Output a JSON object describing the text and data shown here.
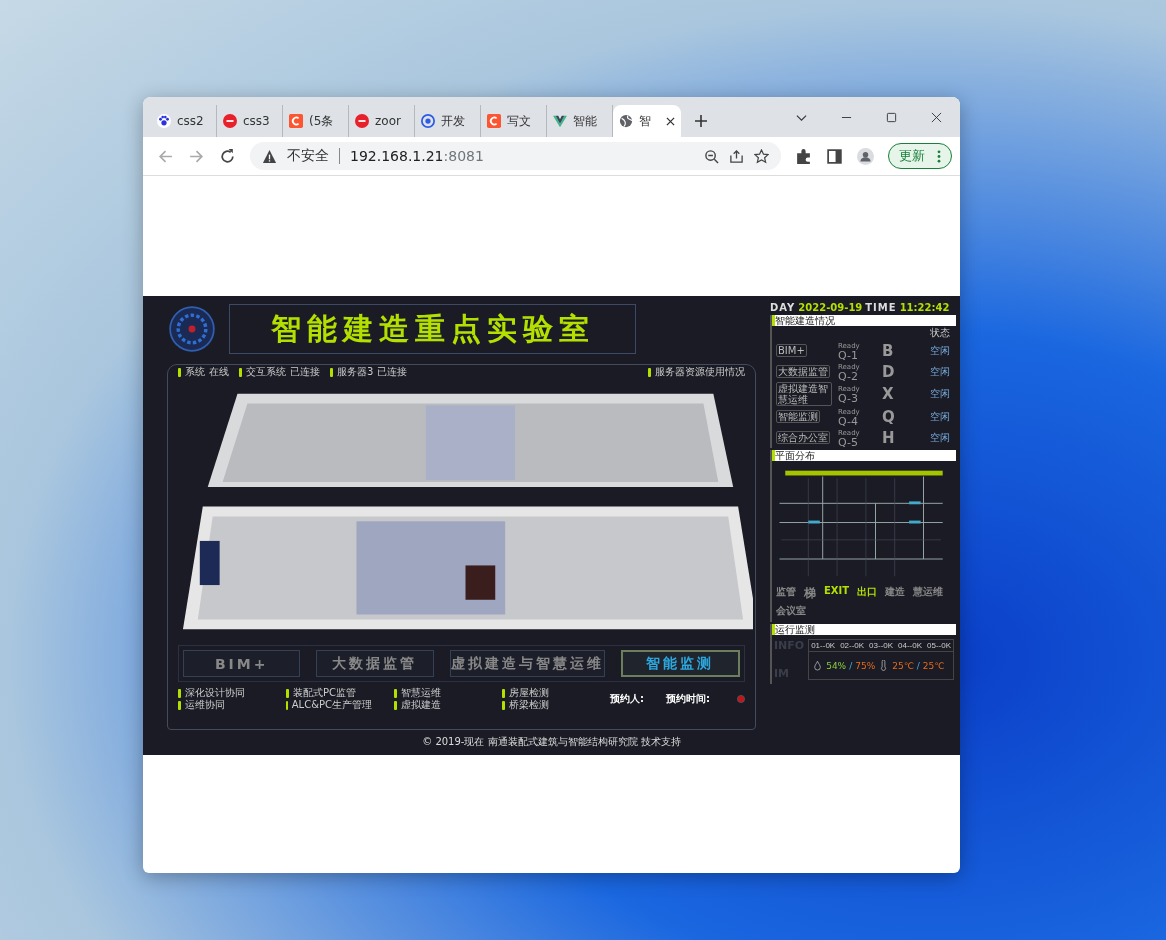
{
  "browser": {
    "tabs": [
      {
        "title": "css2",
        "kind": "paw",
        "selected": false
      },
      {
        "title": "css3",
        "kind": "php",
        "selected": false
      },
      {
        "title": "(5条",
        "kind": "c",
        "selected": false
      },
      {
        "title": "zoor",
        "kind": "php",
        "selected": false
      },
      {
        "title": "开发",
        "kind": "target",
        "selected": false
      },
      {
        "title": "写文",
        "kind": "c",
        "selected": false
      },
      {
        "title": "智能",
        "kind": "vue",
        "selected": false
      },
      {
        "title": "智",
        "kind": "globe",
        "selected": true
      }
    ],
    "address": {
      "security": "不安全",
      "host": "192.168.1.21",
      "port": ":8081"
    },
    "update_button": "更新"
  },
  "dashboard": {
    "title": "智能建造重点实验室",
    "status_items": [
      {
        "label": "系统",
        "value": "在线"
      },
      {
        "label": "交互系统",
        "value": "已连接"
      },
      {
        "label": "服务器3",
        "value": "已连接"
      }
    ],
    "resource_label": "服务器资源使用情况",
    "nav_buttons": [
      {
        "label": "BIM+",
        "selected": false
      },
      {
        "label": "大数据监管",
        "selected": false
      },
      {
        "label": "虚拟建造与智慧运维",
        "selected": false
      },
      {
        "label": "智能监测",
        "selected": true
      }
    ],
    "legend": [
      [
        "深化设计协同",
        "运维协同"
      ],
      [
        "装配式PC监管",
        "ALC&PC生产管理"
      ],
      [
        "智慧运维",
        "虚拟建造"
      ],
      [
        "房屋检测",
        "桥梁检测"
      ]
    ],
    "booking": {
      "person_label": "预约人:",
      "time_label": "预约时间:"
    },
    "footer": "© 2019-现在 南通装配式建筑与智能结构研究院 技术支持",
    "clock": {
      "day_label": "DAY",
      "date": "2022-09-19",
      "time_label": "TIME",
      "time": "11:22:42"
    },
    "rooms_panel": {
      "title": "智能建造情况",
      "status_heading": "状态",
      "rooms": [
        {
          "name": "BIM+",
          "ready": "Ready",
          "code": "Q-1",
          "letter": "B",
          "status": "空闲"
        },
        {
          "name": "大数据监管",
          "ready": "Ready",
          "code": "Q-2",
          "letter": "D",
          "status": "空闲"
        },
        {
          "name": "虚拟建造智慧运维",
          "ready": "Ready",
          "code": "Q-3",
          "letter": "X",
          "status": "空闲"
        },
        {
          "name": "智能监测",
          "ready": "Ready",
          "code": "Q-4",
          "letter": "Q",
          "status": "空闲"
        },
        {
          "name": "综合办公室",
          "ready": "Ready",
          "code": "Q-5",
          "letter": "H",
          "status": "空闲"
        }
      ]
    },
    "floor_plan": {
      "title": "平面分布",
      "room_left_top": "监管",
      "stair": "梯",
      "exit": "EXIT",
      "exit_cn": "出口",
      "room_left_bottom_1": "建造",
      "room_left_bottom_2": "慧运维",
      "meeting": "会议室"
    },
    "info_panel": {
      "title": "运行监测",
      "big_labels": [
        "INFO",
        "IM"
      ],
      "channels": [
        "01--0K",
        "02--0K",
        "03--0K",
        "04--0K",
        "05--0K"
      ],
      "separator": "/",
      "humidity": [
        "54%",
        "75%"
      ],
      "temperature": [
        "25℃",
        "25℃"
      ]
    }
  }
}
